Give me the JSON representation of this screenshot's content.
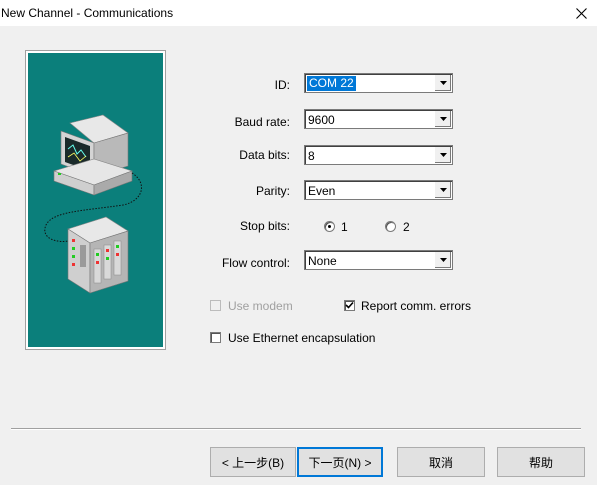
{
  "window": {
    "title": "New Channel - Communications"
  },
  "form": {
    "id": {
      "label": "ID:",
      "value": "COM 22"
    },
    "baud_rate": {
      "label": "Baud rate:",
      "value": "9600"
    },
    "data_bits": {
      "label": "Data bits:",
      "value": "8"
    },
    "parity": {
      "label": "Parity:",
      "value": "Even"
    },
    "stop_bits": {
      "label": "Stop bits:",
      "options": [
        "1",
        "2"
      ],
      "selected": "1"
    },
    "flow_control": {
      "label": "Flow control:",
      "value": "None"
    },
    "use_modem": {
      "label": "Use modem",
      "checked": false,
      "enabled": false
    },
    "report_errors": {
      "label": "Report comm. errors",
      "checked": true
    },
    "ethernet": {
      "label": "Use Ethernet encapsulation",
      "checked": false
    }
  },
  "buttons": {
    "back": "< 上一步(B)",
    "next": "下一页(N) >",
    "cancel": "取消",
    "help": "帮助"
  },
  "colors": {
    "illustration_bg": "#0b7f7b",
    "selection": "#0078d7",
    "dialog_bg": "#f0f0f0"
  }
}
